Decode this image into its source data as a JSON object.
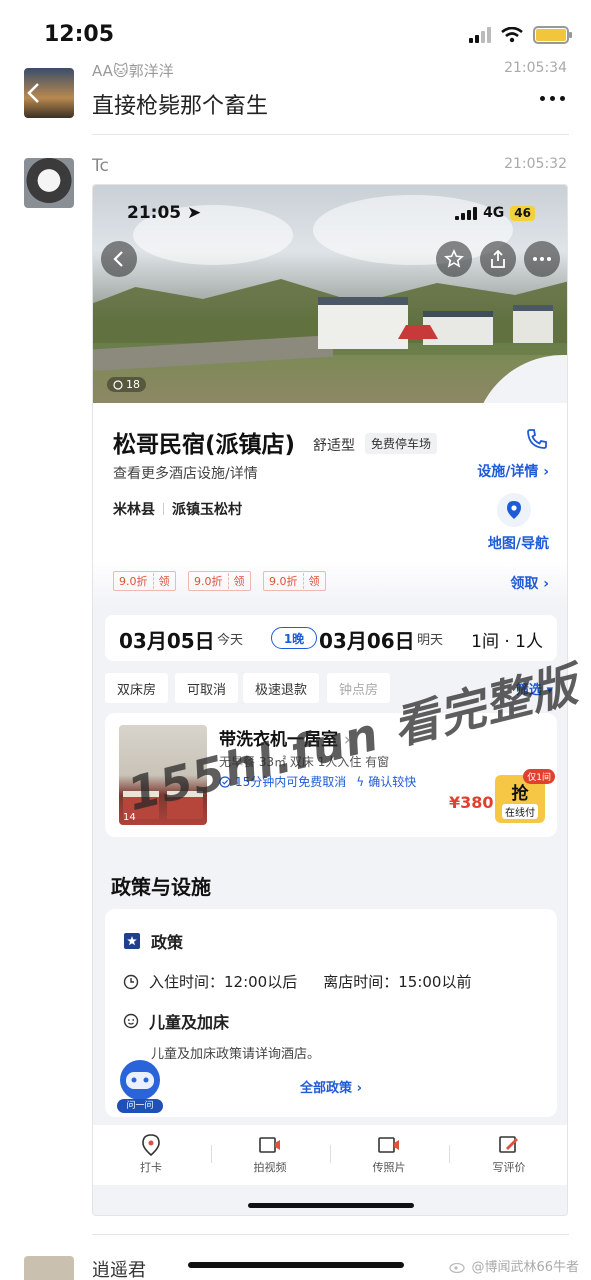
{
  "status_bar": {
    "time": "12:05"
  },
  "previous_message": {
    "sender": "AA🐱郭洋洋",
    "time": "21:05:34",
    "text": "直接枪毙那个畜生"
  },
  "message": {
    "sender": "Tc",
    "time": "21:05:32"
  },
  "screenshot": {
    "status": {
      "time": "21:05",
      "network": "4G",
      "battery": "46"
    },
    "photo_count": "18",
    "hotel": {
      "name": "松哥民宿(派镇店)",
      "type": "舒适型",
      "parking_tag": "免费停车场",
      "more_facilities": "查看更多酒店设施/详情",
      "facilities_link": "设施/详情",
      "county": "米林县",
      "village": "派镇玉松村",
      "map_label": "地图/导航"
    },
    "coupons": [
      {
        "rate": "9.0折",
        "action": "领"
      },
      {
        "rate": "9.0折",
        "action": "领"
      },
      {
        "rate": "9.0折",
        "action": "领"
      }
    ],
    "claim_label": "领取",
    "dates": {
      "checkin": "03月05日",
      "checkin_label": "今天",
      "nights": "1晚",
      "checkout": "03月06日",
      "checkout_label": "明天",
      "rooms_guests": "1间 · 1人"
    },
    "filters": [
      "双床房",
      "可取消",
      "极速退款",
      "钟点房"
    ],
    "filter_label": "筛选",
    "room": {
      "title": "带洗衣机一居室",
      "specs": "无早餐  33㎡  双床  1人入住  有窗",
      "cancel": "15分钟内可免费取消",
      "confirm": "确认较快",
      "photo_count": "14",
      "price": "¥380",
      "grab_label": "抢",
      "pay_label": "在线付",
      "limit_tag": "仅1间"
    },
    "policy": {
      "heading": "政策与设施",
      "section": "政策",
      "checkin_time": "入住时间：12:00以后",
      "checkout_time": "离店时间：15:00以前",
      "children_title": "儿童及加床",
      "children_text": "儿童及加床政策请详询酒店。",
      "all_policies": "全部政策",
      "robot_label": "问一问"
    },
    "toolbar": [
      "打卡",
      "拍视频",
      "传照片",
      "写评价"
    ]
  },
  "watermark": "155hl.fun 看完整版",
  "next_message": {
    "sender": "逍遥君"
  },
  "footer_watermark": "@博闻武林66牛者"
}
